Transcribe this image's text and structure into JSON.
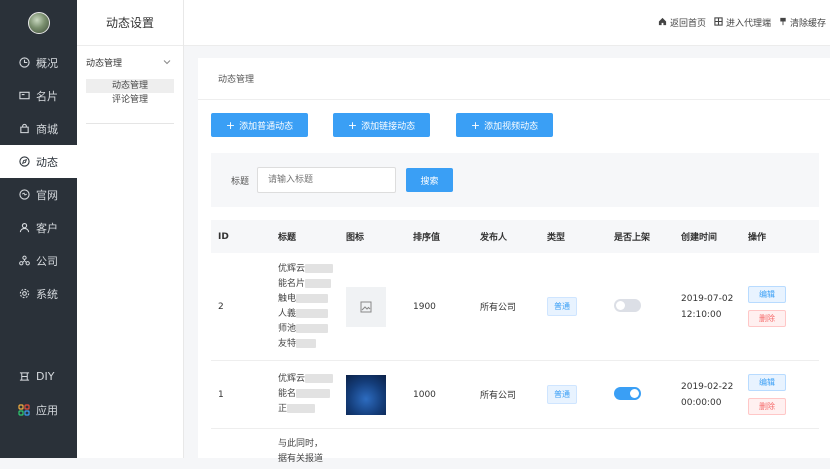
{
  "sidebar": {
    "items": [
      {
        "label": "概况",
        "icon": "clock-icon"
      },
      {
        "label": "名片",
        "icon": "card-icon"
      },
      {
        "label": "商城",
        "icon": "bag-icon"
      },
      {
        "label": "动态",
        "icon": "compass-icon"
      },
      {
        "label": "官网",
        "icon": "globe-icon"
      },
      {
        "label": "客户",
        "icon": "user-icon"
      },
      {
        "label": "公司",
        "icon": "org-icon"
      },
      {
        "label": "系统",
        "icon": "gear-icon"
      }
    ],
    "bottom_items": [
      {
        "label": "DIY",
        "icon": "diy-icon"
      },
      {
        "label": "应用",
        "icon": "apps-icon"
      }
    ]
  },
  "subbar": {
    "title": "动态设置",
    "group": "动态管理",
    "items": [
      "动态管理",
      "评论管理"
    ]
  },
  "topbar": {
    "home": "返回首页",
    "agent": "进入代理端",
    "clear_cache": "清除缓存"
  },
  "main": {
    "breadcrumb": "动态管理",
    "buttons": {
      "add_normal": "添加普通动态",
      "add_link": "添加链接动态",
      "add_video": "添加视频动态"
    },
    "filter": {
      "label": "标题",
      "placeholder": "请输入标题",
      "search": "搜索"
    },
    "columns": [
      "ID",
      "标题",
      "图标",
      "排序值",
      "发布人",
      "类型",
      "是否上架",
      "创建时间",
      "操作"
    ],
    "rows": [
      {
        "id": "2",
        "title_lines": [
          "优辉云",
          "能名片",
          "触电",
          "人義",
          "师池",
          "友特"
        ],
        "sort": "1900",
        "publisher": "所有公司",
        "type": "普通",
        "on_shelf": false,
        "date": "2019-07-02",
        "time": "12:10:00",
        "edit": "编辑",
        "delete": "删除"
      },
      {
        "id": "1",
        "title_lines": [
          "优辉云",
          "能名",
          "正"
        ],
        "sort": "1000",
        "publisher": "所有公司",
        "type": "普通",
        "on_shelf": true,
        "date": "2019-02-22",
        "time": "00:00:00",
        "edit": "编辑",
        "delete": "删除"
      }
    ],
    "partial_row_lines": [
      "与此同时，",
      "据有关报道"
    ]
  },
  "colors": {
    "sidebar_bg": "#2a3139",
    "primary": "#3a9ff5",
    "danger": "#f56c6c"
  }
}
